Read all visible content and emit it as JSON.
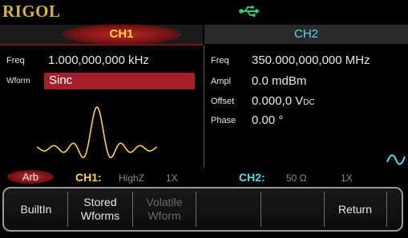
{
  "brand": "RIGOL",
  "status_icons": {
    "usb": "usb-icon"
  },
  "channels": {
    "ch1": {
      "title": "CH1",
      "color": "#ffd23f"
    },
    "ch2": {
      "title": "CH2",
      "color": "#58d7e8"
    }
  },
  "ch1_params": {
    "freq_label": "Freq",
    "freq_value": "1.000,000,000 kHz",
    "wform_label": "Wform",
    "wform_value": "Sinc"
  },
  "ch2_params": {
    "freq_label": "Freq",
    "freq_value": "350.000,000,000 MHz",
    "ampl_label": "Ampl",
    "ampl_value": "0.0 mdBm",
    "offset_label": "Offset",
    "offset_value": "0.000,0 V",
    "offset_unit_sub": "DC",
    "phase_label": "Phase",
    "phase_value": "0.00 °"
  },
  "ch2_waveform_icon": "sine-icon",
  "status": {
    "mode": "Arb",
    "ch1_label": "CH1:",
    "ch1_load": "HighZ",
    "ch1_mult": "1X",
    "ch2_label": "CH2:",
    "ch2_load": "50 Ω",
    "ch2_mult": "1X"
  },
  "softkeys": [
    {
      "label": "BuiltIn",
      "enabled": true
    },
    {
      "line1": "Stored",
      "line2": "Wforms",
      "enabled": true
    },
    {
      "line1": "Volatile",
      "line2": "Wform",
      "enabled": false
    },
    {
      "label": "",
      "enabled": true
    },
    {
      "label": "",
      "enabled": true
    },
    {
      "label": "Return",
      "enabled": true
    }
  ],
  "colors": {
    "accent_red": "#a3202b",
    "ch1": "#ffd23f",
    "ch2": "#58d7e8",
    "usb": "#2bd36b"
  }
}
